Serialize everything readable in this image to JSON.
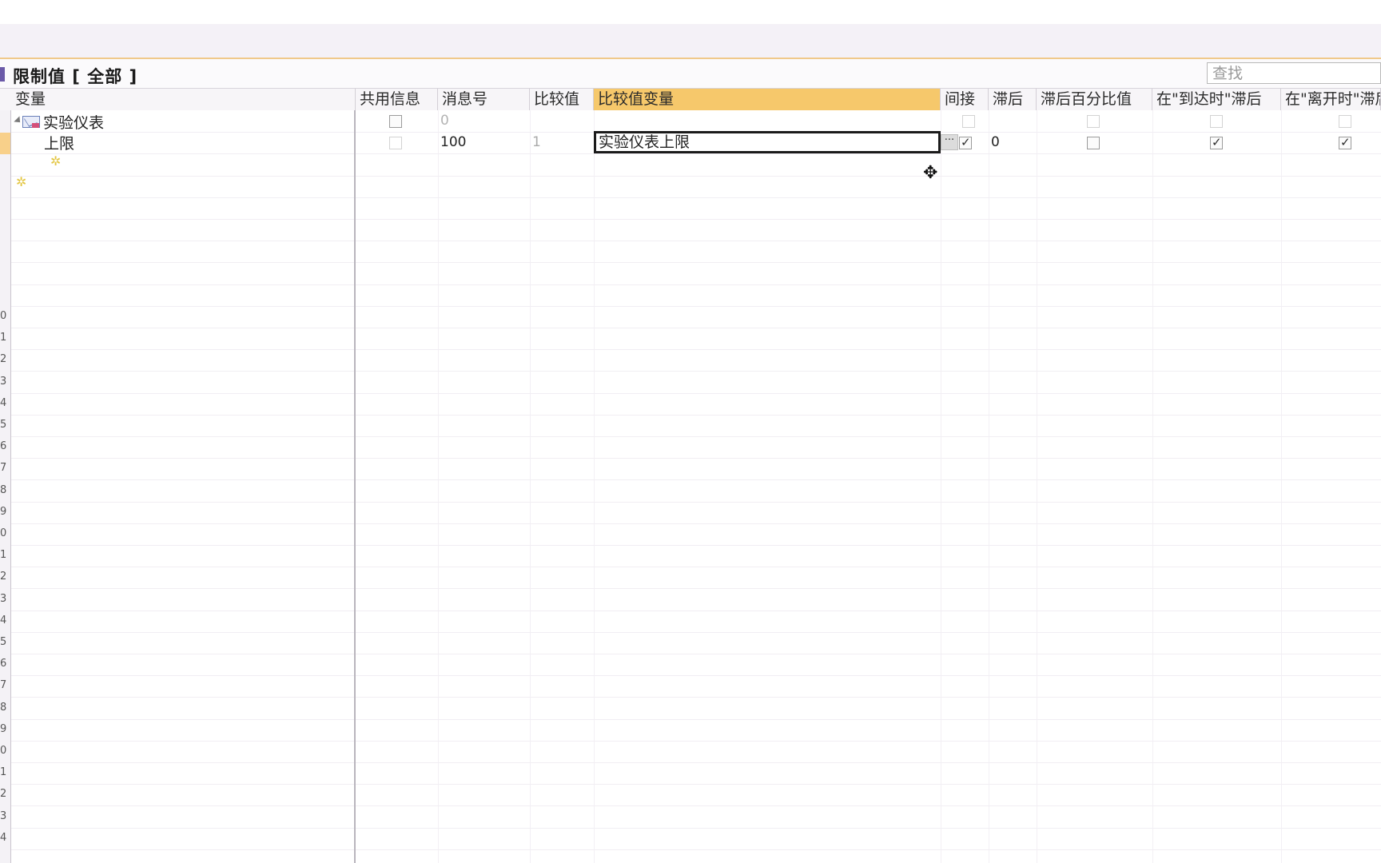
{
  "panel": {
    "title": "限制值 [ 全部 ]",
    "search_placeholder": "查找"
  },
  "columns": {
    "variable": "变量",
    "shared_info": "共用信息",
    "message_no": "消息号",
    "compare_value": "比较值",
    "compare_variable": "比较值变量",
    "indirect": "间接",
    "delay": "滞后",
    "delay_percent": "滞后百分比值",
    "on_arrive_delay": "在\"到达时\"滞后",
    "on_leave_delay": "在\"离开时\"滞后"
  },
  "rows": [
    {
      "variable": "实验仪表",
      "shared_info": false,
      "message_no": "0",
      "compare_value": "",
      "compare_variable": "",
      "indirect": false,
      "delay": "",
      "delay_percent": false,
      "on_arrive_delay": false,
      "on_leave_delay": false
    },
    {
      "variable": "上限",
      "shared_info": false,
      "message_no": "100",
      "compare_value": "1",
      "compare_variable": "实验仪表上限",
      "indirect": true,
      "delay": "0",
      "delay_percent": false,
      "on_arrive_delay": true,
      "on_leave_delay": true
    }
  ],
  "row_gutter_numbers": [
    "0",
    "1",
    "2",
    "3",
    "4",
    "5",
    "6",
    "7",
    "8",
    "9",
    "0",
    "1",
    "2",
    "3",
    "4",
    "5",
    "6",
    "7",
    "8",
    "9",
    "0",
    "1",
    "2",
    "3",
    "4"
  ],
  "icons": {
    "title": "limit-value-icon",
    "variable_row": "envelope-icon",
    "new_row": "new-item-star-icon",
    "browse": "ellipsis-icon",
    "cursor": "move-cursor-icon"
  },
  "colors": {
    "active_header": "#f6c86b",
    "orange_line": "#f0c98a",
    "selected_row_marker": "#f8d08a"
  }
}
